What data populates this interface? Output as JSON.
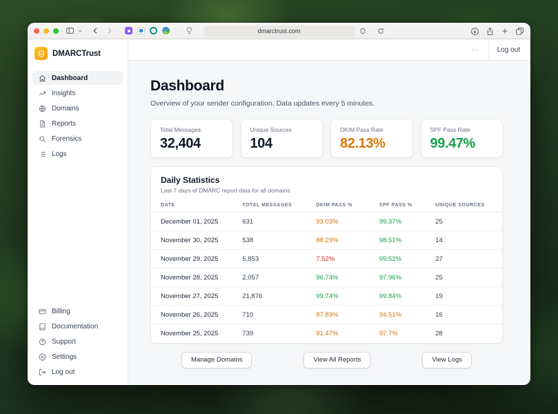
{
  "browser": {
    "url": "dmarctrust.com"
  },
  "theme": {
    "accent_orange": "#f59e0b",
    "green": "#16a34a",
    "warn_orange": "#d97706",
    "red": "#dc2626",
    "dark_text": "#111827"
  },
  "app": {
    "brand": "DMARCTrust",
    "header": {
      "menu": "⋯",
      "logout": "Log out"
    },
    "sidebar": {
      "items": [
        {
          "label": "Dashboard"
        },
        {
          "label": "Insights"
        },
        {
          "label": "Domains"
        },
        {
          "label": "Reports"
        },
        {
          "label": "Forensics"
        },
        {
          "label": "Logs"
        }
      ],
      "footer_items": [
        {
          "label": "Billing"
        },
        {
          "label": "Documentation"
        },
        {
          "label": "Support"
        },
        {
          "label": "Settings"
        },
        {
          "label": "Log out"
        }
      ]
    },
    "page": {
      "title": "Dashboard",
      "subtitle": "Overview of your sender configuration. Data updates every 5 minutes.",
      "stats": [
        {
          "label": "Total Messages",
          "value": "32,404",
          "color": "#111827"
        },
        {
          "label": "Unique Sources",
          "value": "104",
          "color": "#111827"
        },
        {
          "label": "DKIM Pass Rate",
          "value": "82.13%",
          "color": "#d97706"
        },
        {
          "label": "SPF Pass Rate",
          "value": "99.47%",
          "color": "#16a34a"
        }
      ],
      "daily": {
        "title": "Daily Statistics",
        "subtitle": "Last 7 days of DMARC report data for all domains",
        "columns": [
          "Date",
          "Total Messages",
          "DKIM Pass %",
          "SPF Pass %",
          "Unique Sources"
        ],
        "rows": [
          {
            "date": "December 01, 2025",
            "total": "631",
            "dkim": "93.03%",
            "dkim_color": "#d97706",
            "spf": "99.37%",
            "spf_color": "#16a34a",
            "sources": "25"
          },
          {
            "date": "November 30, 2025",
            "total": "538",
            "dkim": "88.29%",
            "dkim_color": "#d97706",
            "spf": "98.51%",
            "spf_color": "#16a34a",
            "sources": "14"
          },
          {
            "date": "November 29, 2025",
            "total": "5,853",
            "dkim": "7.52%",
            "dkim_color": "#dc2626",
            "spf": "99.52%",
            "spf_color": "#16a34a",
            "sources": "27"
          },
          {
            "date": "November 28, 2025",
            "total": "2,057",
            "dkim": "96.74%",
            "dkim_color": "#16a34a",
            "spf": "97.96%",
            "spf_color": "#16a34a",
            "sources": "25"
          },
          {
            "date": "November 27, 2025",
            "total": "21,876",
            "dkim": "99.74%",
            "dkim_color": "#16a34a",
            "spf": "99.84%",
            "spf_color": "#16a34a",
            "sources": "19"
          },
          {
            "date": "November 26, 2025",
            "total": "710",
            "dkim": "87.89%",
            "dkim_color": "#d97706",
            "spf": "94.51%",
            "spf_color": "#d97706",
            "sources": "16"
          },
          {
            "date": "November 25, 2025",
            "total": "739",
            "dkim": "91.47%",
            "dkim_color": "#d97706",
            "spf": "97.7%",
            "spf_color": "#d97706",
            "sources": "28"
          }
        ]
      },
      "actions": [
        {
          "label": "Manage Domains"
        },
        {
          "label": "View All Reports"
        },
        {
          "label": "View Logs"
        }
      ]
    }
  }
}
